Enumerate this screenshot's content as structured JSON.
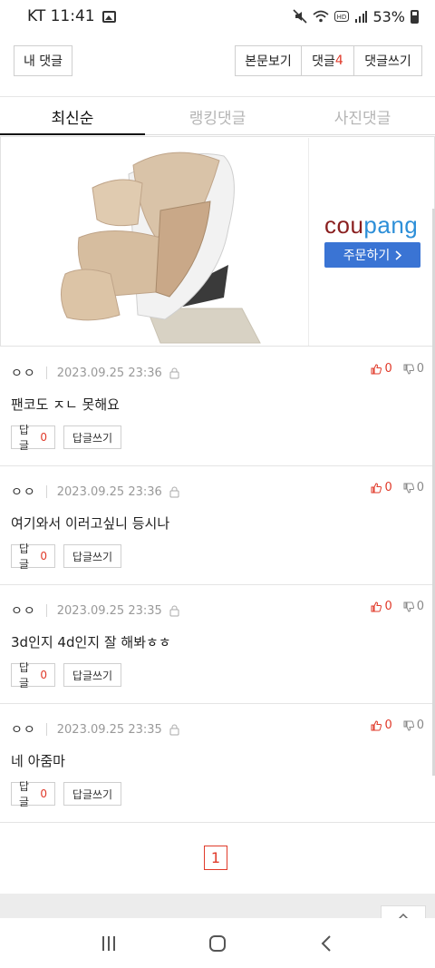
{
  "status_bar": {
    "time_label": "KT 11:41",
    "battery": "53%"
  },
  "top_actions": {
    "my_comments": "내 댓글",
    "view_article": "본문보기",
    "comments_label": "댓글",
    "comments_count": "4",
    "write_comment": "댓글쓰기"
  },
  "tabs": [
    {
      "label": "최신순",
      "active": true
    },
    {
      "label": "랭킹댓글",
      "active": false
    },
    {
      "label": "사진댓글",
      "active": false
    }
  ],
  "ad": {
    "brand_part1": "cou",
    "brand_part2": "pang",
    "order_label": "주문하기"
  },
  "comments": [
    {
      "author": "ㅇㅇ",
      "date": "2023.09.25 23:36",
      "text": "팬코도 ㅈㄴ 못해요",
      "up": "0",
      "down": "0",
      "reply_label": "답글",
      "reply_count": "0",
      "write_reply": "답글쓰기"
    },
    {
      "author": "ㅇㅇ",
      "date": "2023.09.25 23:36",
      "text": "여기와서 이러고싶니 등시나",
      "up": "0",
      "down": "0",
      "reply_label": "답글",
      "reply_count": "0",
      "write_reply": "답글쓰기"
    },
    {
      "author": "ㅇㅇ",
      "date": "2023.09.25 23:35",
      "text": "3d인지 4d인지 잘 해봐ㅎㅎ",
      "up": "0",
      "down": "0",
      "reply_label": "답글",
      "reply_count": "0",
      "write_reply": "답글쓰기"
    },
    {
      "author": "ㅇㅇ",
      "date": "2023.09.25 23:35",
      "text": "네 아줌마",
      "up": "0",
      "down": "0",
      "reply_label": "답글",
      "reply_count": "0",
      "write_reply": "답글쓰기"
    }
  ],
  "pagination": {
    "current": "1"
  },
  "colors": {
    "accent_red": "#e03a2a",
    "coupang_blue": "#3a74d4"
  }
}
